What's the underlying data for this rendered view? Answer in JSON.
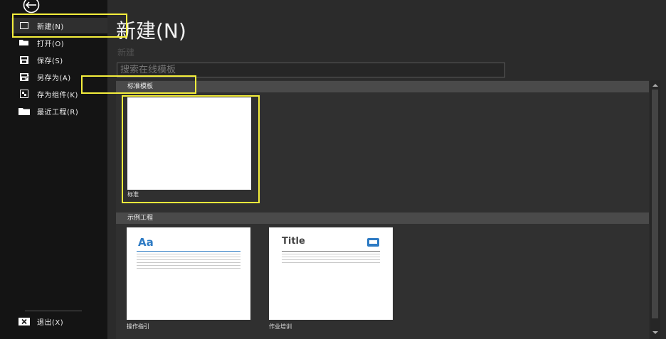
{
  "sidebar": {
    "back_label": "返回",
    "items": [
      {
        "label": "新建(N)",
        "icon": "new-document-icon"
      },
      {
        "label": "打开(O)",
        "icon": "open-folder-icon"
      },
      {
        "label": "保存(S)",
        "icon": "save-icon"
      },
      {
        "label": "另存为(A)",
        "icon": "save-as-icon"
      },
      {
        "label": "存为组件(K)",
        "icon": "save-component-icon"
      },
      {
        "label": "最近工程(R)",
        "icon": "recent-folder-icon"
      }
    ],
    "exit_label": "退出(X)"
  },
  "main": {
    "title": "新建(N)",
    "subtitle": "新建",
    "search_placeholder": "搜索在线模板"
  },
  "sections": [
    {
      "title": "标准模板",
      "cards": [
        {
          "label": "标准"
        }
      ]
    },
    {
      "title": "示例工程",
      "cards": [
        {
          "label": "操作指引",
          "preview_heading": "Aa"
        },
        {
          "label": "作业培训",
          "preview_heading": "Title"
        }
      ]
    }
  ],
  "colors": {
    "accent_blue": "#2e7bc4",
    "highlight": "#f5ef3c"
  }
}
